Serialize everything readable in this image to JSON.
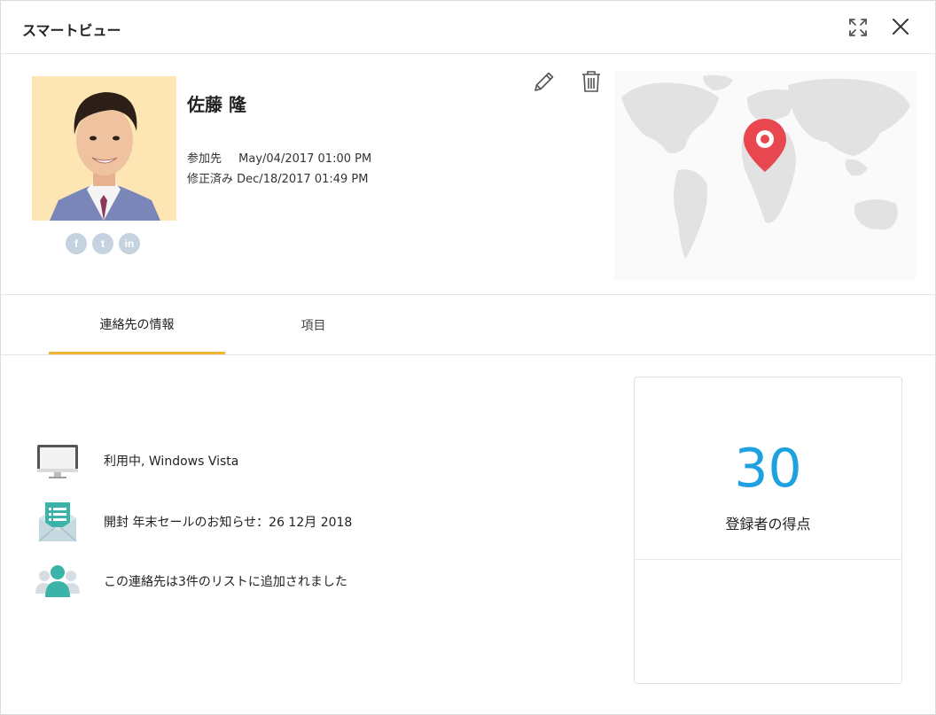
{
  "header": {
    "title": "スマートビュー",
    "expand_icon": "expand-icon",
    "close_icon": "close-icon"
  },
  "profile": {
    "name": "佐藤 隆",
    "joined_label": "参加先",
    "joined_value": "May/04/2017 01:00 PM",
    "modified_label": "修正済み",
    "modified_value": "Dec/18/2017 01:49 PM",
    "social": [
      {
        "icon": "facebook-icon",
        "glyph": "f"
      },
      {
        "icon": "twitter-icon",
        "glyph": "t"
      },
      {
        "icon": "linkedin-icon",
        "glyph": "in"
      }
    ],
    "actions": {
      "edit_icon": "pencil-icon",
      "delete_icon": "trash-icon"
    },
    "map_pin_color": "#e8474f"
  },
  "tabs": [
    {
      "label": "連絡先の情報",
      "active": true
    },
    {
      "label": "項目",
      "active": false
    }
  ],
  "activity": [
    {
      "icon": "monitor-icon",
      "text": "利用中, Windows Vista"
    },
    {
      "icon": "open-mail-icon",
      "text": "開封 年末セールのお知らせ：26 12月 2018"
    },
    {
      "icon": "group-icon",
      "text": "この連絡先は3件のリストに追加されました"
    }
  ],
  "score": {
    "value": "30",
    "label": "登録者の得点",
    "color": "#1ea1e0"
  },
  "colors": {
    "tab_accent": "#f2b233",
    "teal": "#3bb3a9"
  }
}
